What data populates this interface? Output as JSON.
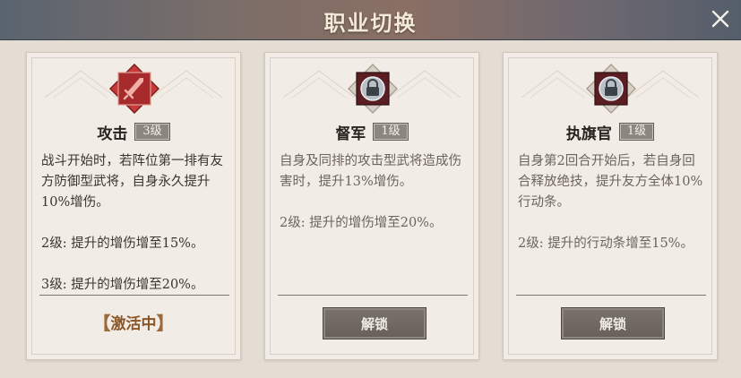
{
  "window": {
    "title": "职业切换"
  },
  "classes": [
    {
      "name": "攻击",
      "level": "3级",
      "emblem": "sword-icon",
      "emblem_color": "#c8393a",
      "descriptions": [
        "战斗开始时，若阵位第一排有友方防御型武将，自身永久提升10%增伤。",
        "2级: 提升的增伤增至15%。",
        "3级: 提升的增伤增至20%。"
      ],
      "status": "激活中"
    },
    {
      "name": "督军",
      "level": "1级",
      "emblem": "lock-icon",
      "descriptions": [
        "自身及同排的攻击型武将造成伤害时，提升13%增伤。",
        "2级: 提升的增伤增至20%。"
      ],
      "button": "解锁"
    },
    {
      "name": "执旗官",
      "level": "1级",
      "emblem": "lock-icon",
      "descriptions": [
        "自身第2回合开始后，若自身回合释放绝技，提升友方全体10%行动条。",
        "2级: 提升的行动条增至15%。"
      ],
      "button": "解锁"
    }
  ]
}
